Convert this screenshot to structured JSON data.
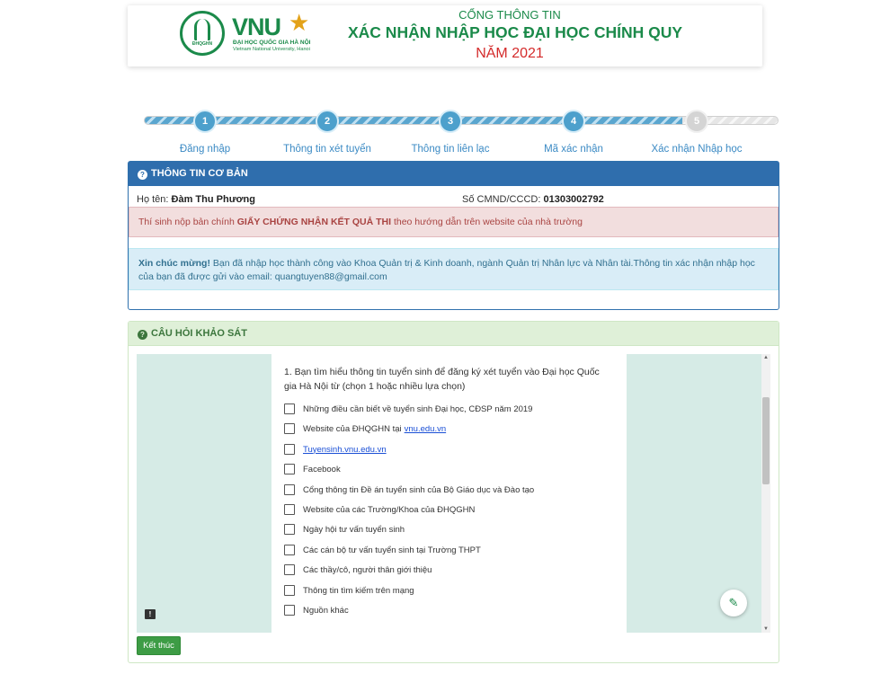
{
  "header": {
    "logo_word": "VNU",
    "logo_badge": "ĐHQGHN",
    "logo_sub1": "ĐẠI HỌC QUỐC GIA HÀ NỘI",
    "logo_sub2": "Vietnam National University, Hanoi",
    "line1": "CỔNG THÔNG TIN",
    "line2": "XÁC NHẬN NHẬP HỌC ĐẠI HỌC CHÍNH QUY",
    "line3": "NĂM 2021"
  },
  "stepper": {
    "progress": 0.85,
    "steps": [
      {
        "number": "1",
        "label": "Đăng nhập",
        "done": true
      },
      {
        "number": "2",
        "label": "Thông tin xét tuyển",
        "done": true
      },
      {
        "number": "3",
        "label": "Thông tin liên lạc",
        "done": true
      },
      {
        "number": "4",
        "label": "Mã xác nhận",
        "done": true
      },
      {
        "number": "5",
        "label": "Xác nhận Nhập học",
        "done": false
      }
    ]
  },
  "basic_info": {
    "title": "THÔNG TIN CƠ BẢN",
    "name_label": "Họ tên:",
    "name_value": "Đàm Thu Phương",
    "id_label": "Số CMND/CCCD:",
    "id_value": "01303002792",
    "alert_pre": "Thí sinh nộp bản chính ",
    "alert_bold": "GIẤY CHỨNG NHẬN KẾT QUẢ THI",
    "alert_post": " theo hướng dẫn trên website của nhà trường",
    "congrats_bold": "Xin chúc mừng!",
    "congrats_text": " Bạn đã nhập học thành công vào Khoa Quản trị & Kinh doanh, ngành Quản trị Nhân lực và Nhân tài.Thông tin xác nhận nhập học của bạn đã được gửi vào email: quangtuyen88@gmail.com"
  },
  "survey": {
    "title": "CÂU HỎI KHẢO SÁT",
    "question": "1. Bạn tìm hiểu thông tin tuyển sinh để đăng ký xét tuyển vào Đại học Quốc gia Hà Nội từ (chọn 1 hoặc nhiều lựa chọn)",
    "options": [
      {
        "text": "Những điều cần biết về tuyển sinh Đại học, CĐSP năm 2019"
      },
      {
        "text": "Website của ĐHQGHN tại",
        "link": "vnu.edu.vn"
      },
      {
        "text": "",
        "link": "Tuyensinh.vnu.edu.vn"
      },
      {
        "text": "Facebook"
      },
      {
        "text": "Cổng thông tin Đề án tuyển sinh của Bộ Giáo dục và Đào tạo"
      },
      {
        "text": "Website của các Trường/Khoa của ĐHQGHN"
      },
      {
        "text": "Ngày hội tư vấn tuyển sinh"
      },
      {
        "text": "Các cán bộ tư vấn tuyển sinh tại Trường THPT"
      },
      {
        "text": "Các thầy/cô, người thân giới thiệu"
      },
      {
        "text": "Thông tin tìm kiếm trên mạng"
      },
      {
        "text": "Nguồn khác"
      }
    ],
    "finish_button": "Kết thúc"
  },
  "colors": {
    "brand_green": "#1b8a4a",
    "primary_blue": "#2f6ead",
    "year_red": "#d42b2b"
  },
  "icons": {
    "header_info": "question-circle-icon",
    "edit": "pencil-icon",
    "feedback": "feedback-icon"
  }
}
